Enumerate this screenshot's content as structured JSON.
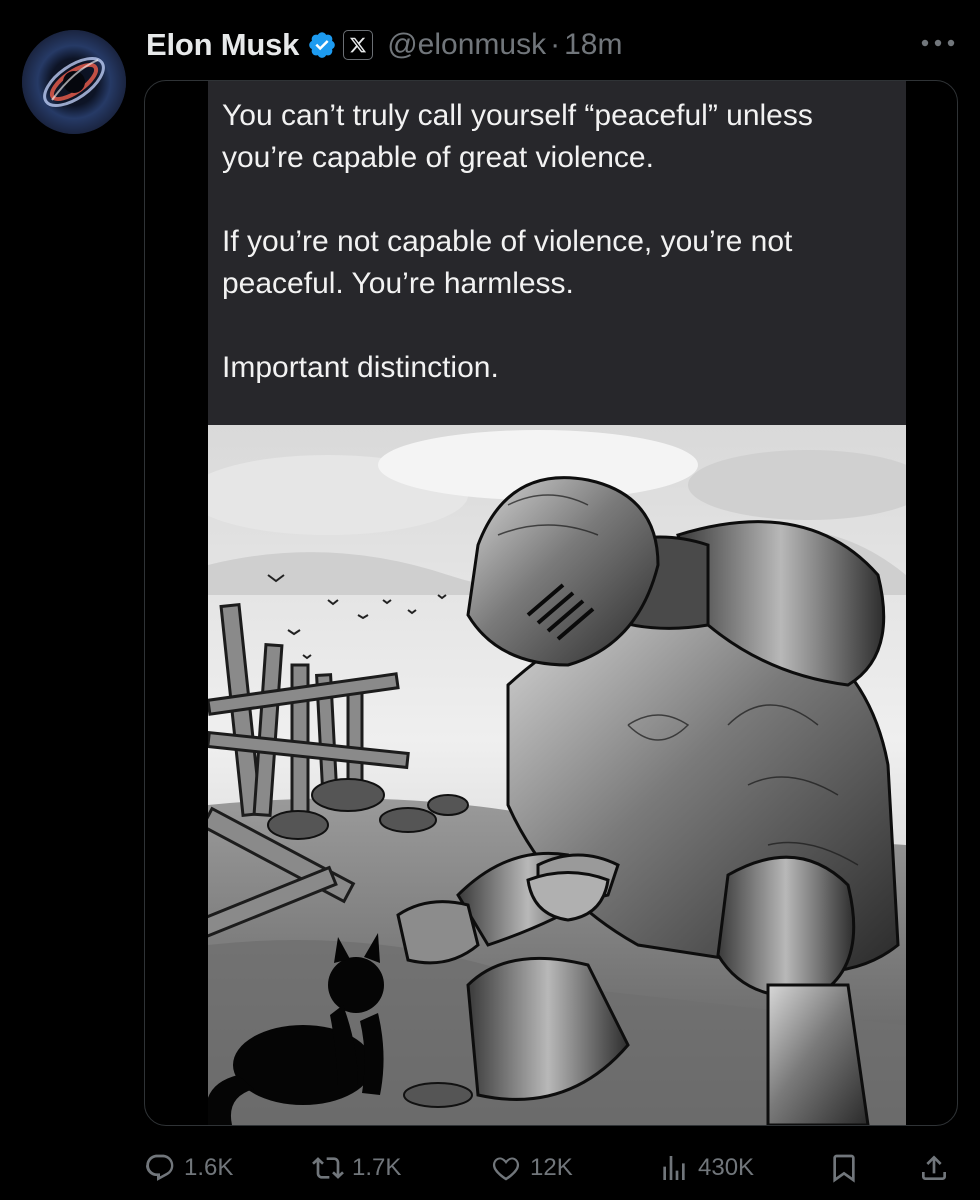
{
  "post": {
    "author_name": "Elon Musk",
    "handle": "@elonmusk",
    "separator": "·",
    "time": "18m"
  },
  "media": {
    "quote_paragraphs": [
      "You can’t truly call yourself “peaceful” unless you’re capable of great violence.",
      "If you’re not capable of violence, you’re not peaceful. You’re harmless.",
      "Important distinction."
    ]
  },
  "actions": {
    "replies": "1.6K",
    "reposts": "1.7K",
    "likes": "12K",
    "views": "430K"
  },
  "icons": {
    "avatar": "avatar-image",
    "verified": "verified-badge-icon",
    "affiliate": "x-logo-icon",
    "more": "more-options-icon",
    "reply": "reply-icon",
    "repost": "repost-icon",
    "like": "heart-icon",
    "views": "views-chart-icon",
    "bookmark": "bookmark-icon",
    "share": "share-icon"
  },
  "colors": {
    "background": "#000000",
    "primary_text": "#e7e9ea",
    "secondary_text": "#71767b",
    "verified_blue": "#1d9bf0",
    "border": "#2f3336",
    "quote_panel": "#27272b"
  }
}
